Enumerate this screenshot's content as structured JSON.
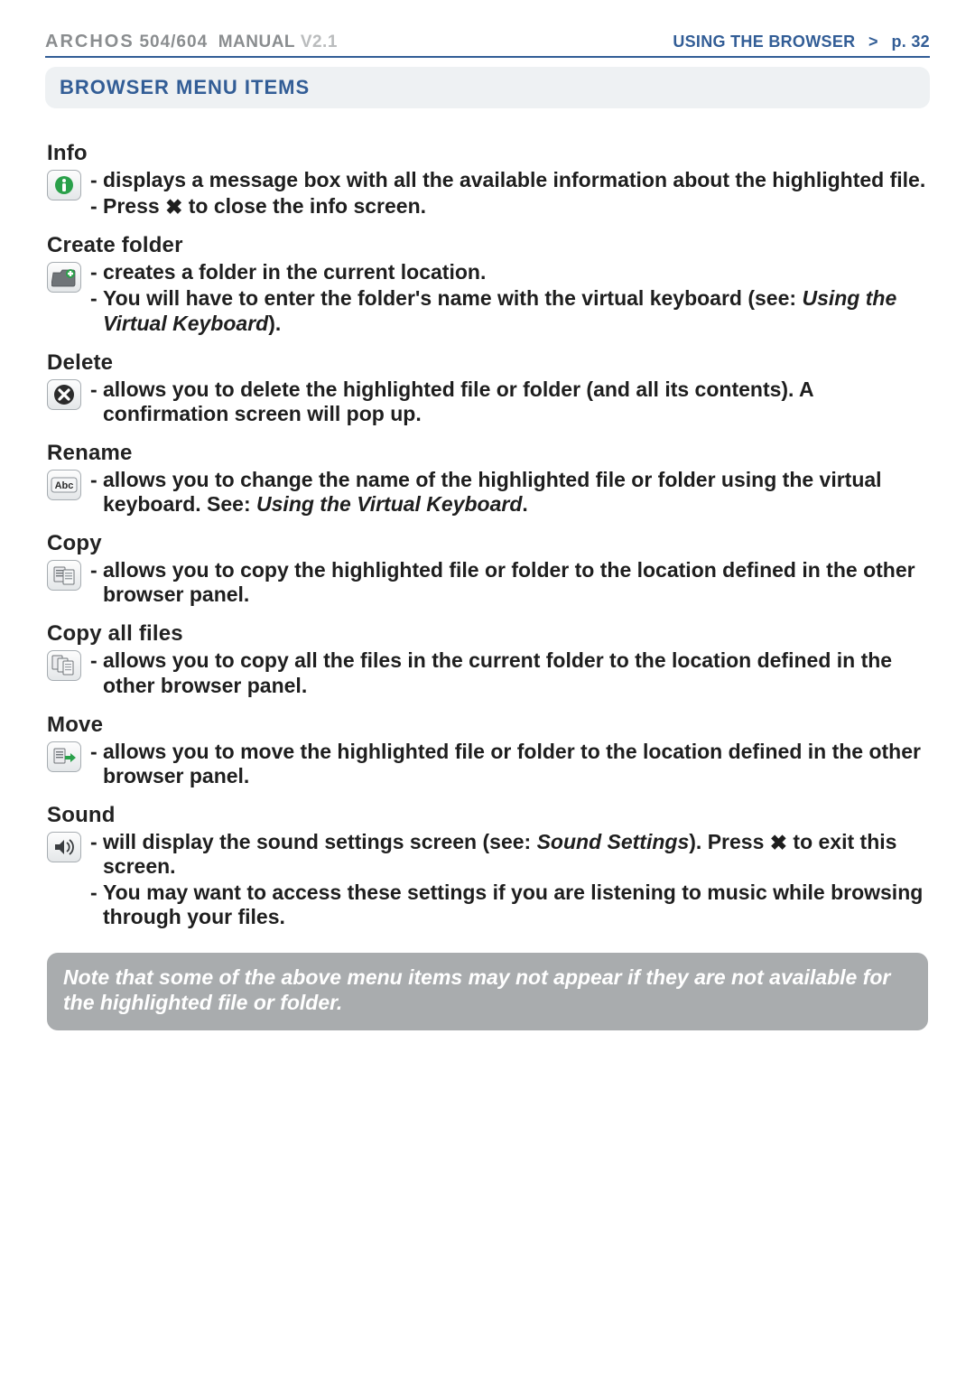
{
  "header": {
    "brand": "ARCHOS",
    "model": "504/604",
    "manual": "MANUAL",
    "version": "V2.1",
    "section_name": "USING THE BROWSER",
    "chevron": ">",
    "page_label": "p. 32"
  },
  "section_title": "BROWSER MENU ITEMS",
  "items": {
    "info": {
      "title": "Info",
      "b1a": "displays a message box with all the available information about the highlighted file.",
      "b2a": "Press ",
      "b2b": " to close the info screen."
    },
    "create_folder": {
      "title": "Create folder",
      "b1": "creates a folder in the current location.",
      "b2a": "You will have to enter the folder's name with the virtual keyboard (see: ",
      "b2link": "Using the Virtual Keyboard",
      "b2b": ")."
    },
    "delete": {
      "title": "Delete",
      "b1": "allows you to delete the highlighted file or folder (and all its contents). A confirmation screen will pop up."
    },
    "rename": {
      "title": "Rename",
      "b1a": "allows you to change the name of the highlighted file or folder using the virtual keyboard. See: ",
      "b1link": "Using the Virtual Keyboard",
      "b1b": "."
    },
    "copy": {
      "title": "Copy",
      "b1": "allows you to copy the highlighted file or folder to the location defined in the other browser panel."
    },
    "copy_all": {
      "title": "Copy all files",
      "b1": "allows you to copy all the files in the current folder to the location defined in the other browser panel."
    },
    "move": {
      "title": "Move",
      "b1": "allows you to move the highlighted file or folder to the location defined in the other browser panel."
    },
    "sound": {
      "title": "Sound",
      "b1a": "will display the sound settings screen (see: ",
      "b1link": "Sound Settings",
      "b1b": "). Press ",
      "b1c": " to exit this screen.",
      "b2": "You may want to access these settings if you are listening to music while browsing through your files."
    }
  },
  "note": "Note that some of the above menu items may not appear if they are not available for the highlighted file or folder.",
  "glyphs": {
    "x": "✖",
    "dash": "-"
  }
}
